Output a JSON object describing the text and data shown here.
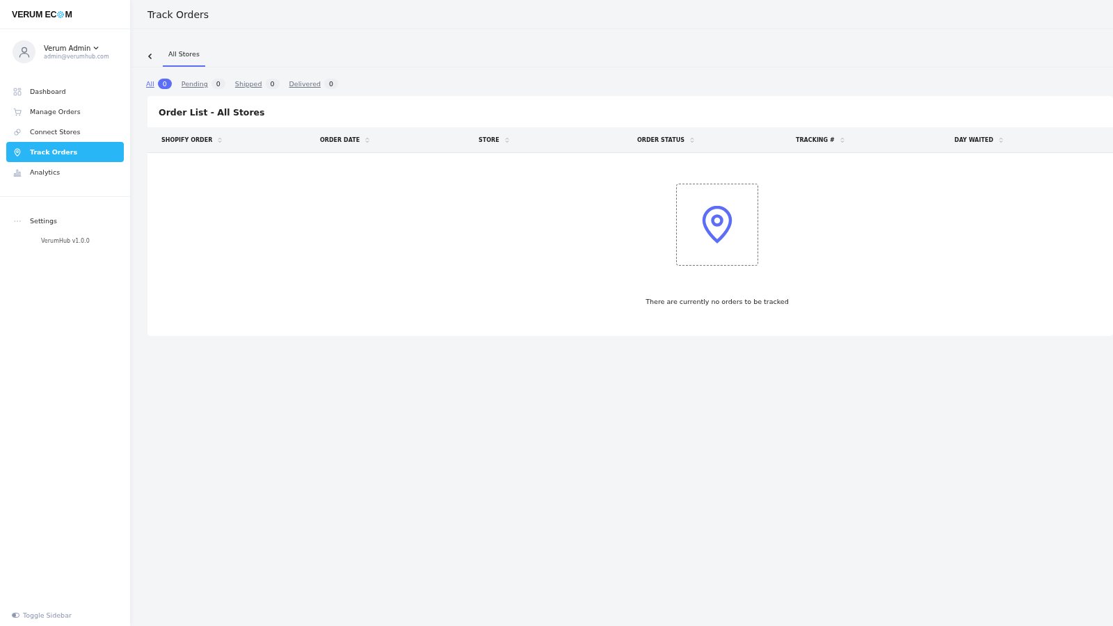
{
  "logo": {
    "before": "VERUM EC",
    "after": "M"
  },
  "user": {
    "name": "Verum Admin",
    "email": "admin@verumhub.com"
  },
  "nav": [
    {
      "label": "Dashboard",
      "kind": "grid",
      "selected": false
    },
    {
      "label": "Manage Orders",
      "kind": "cart",
      "selected": false
    },
    {
      "label": "Connect Stores",
      "kind": "link",
      "selected": false
    },
    {
      "label": "Track Orders",
      "kind": "pin",
      "selected": true
    },
    {
      "label": "Analytics",
      "kind": "chart",
      "selected": false
    }
  ],
  "settings": "Settings",
  "version": "VerumHub v1.0.0",
  "toggle": "Toggle Sidebar",
  "page_title": "Track Orders",
  "tabs": [
    {
      "label": "All Stores",
      "selected": true
    }
  ],
  "filters": [
    {
      "label": "All",
      "count": "0",
      "selected": true
    },
    {
      "label": "Pending",
      "count": "0",
      "selected": false
    },
    {
      "label": "Shipped",
      "count": "0",
      "selected": false
    },
    {
      "label": "Delivered",
      "count": "0",
      "selected": false
    }
  ],
  "card_title": "Order List - All Stores",
  "columns": [
    "SHOPIFY ORDER",
    "ORDER DATE",
    "STORE",
    "ORDER STATUS",
    "TRACKING #",
    "DAY WAITED"
  ],
  "empty_message": "There are currently no orders to be tracked"
}
